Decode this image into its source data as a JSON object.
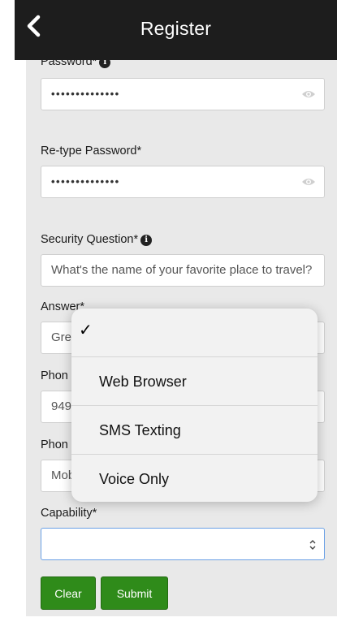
{
  "header": {
    "title": "Register"
  },
  "form": {
    "password": {
      "label": "Password*",
      "value": "••••••••••••••"
    },
    "retype_password": {
      "label": "Re-type Password*",
      "value": "••••••••••••••"
    },
    "security_question": {
      "label": "Security Question*",
      "value": "What's the name of your favorite place to travel?"
    },
    "answer": {
      "label": "Answer*",
      "value": "Gre"
    },
    "phone": {
      "label": "Phon",
      "value": "949"
    },
    "phone_type": {
      "label": "Phon",
      "value": "Mob"
    },
    "capability": {
      "label": "Capability*",
      "value": ""
    }
  },
  "buttons": {
    "clear": "Clear",
    "submit": "Submit"
  },
  "dropdown": {
    "check_glyph": "✓",
    "options": [
      {
        "label": "",
        "selected": true
      },
      {
        "label": "Web Browser",
        "selected": false
      },
      {
        "label": "SMS Texting",
        "selected": false
      },
      {
        "label": "Voice Only",
        "selected": false
      }
    ]
  },
  "colors": {
    "header_bg": "#1d1d1d",
    "content_bg": "#e9e9e9",
    "button_green": "#2f8b1a",
    "focus_border": "#6aa0e6"
  }
}
